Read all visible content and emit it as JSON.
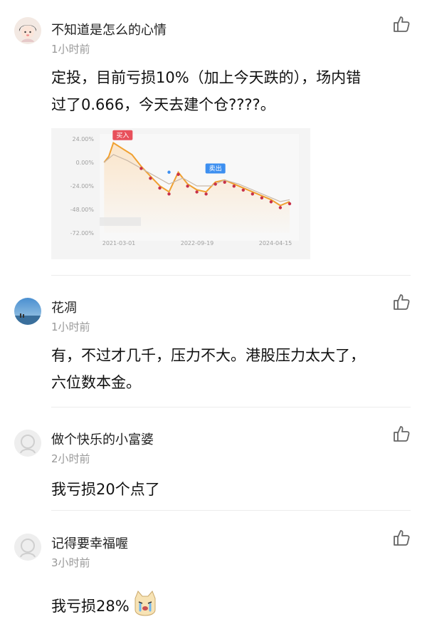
{
  "comments": [
    {
      "username": "不知道是怎么的心情",
      "time": "1小时前",
      "text_line1": "定投，目前亏损10%（加上今天跌的），场内错",
      "text_line2": "过了0.666，今天去建个仓????。",
      "avatar_icon": "girl-avatar-icon"
    },
    {
      "username": "花凋",
      "time": "1小时前",
      "text_line1": "有，不过才几千，压力不大。港股压力太大了，",
      "text_line2": "六位数本金。",
      "avatar_icon": "seaside-avatar-icon"
    },
    {
      "username": "做个快乐的小富婆",
      "time": "2小时前",
      "text_line1": "我亏损20个点了",
      "avatar_icon": "default-avatar-icon"
    },
    {
      "username": "记得要幸福喔",
      "time": "3小时前",
      "text_line1": "我亏损28%",
      "avatar_icon": "default-avatar-icon"
    }
  ],
  "chart_data": {
    "type": "line",
    "y_ticks": [
      "24.00%",
      "0.00%",
      "-24.00%",
      "-48.00%",
      "-72.00%"
    ],
    "x_ticks": [
      "2021-03-01",
      "2022-09-19",
      "2024-04-15"
    ],
    "ylim": [
      -72,
      24
    ],
    "markers": {
      "buy": "买入",
      "sell": "卖出"
    },
    "series": [
      {
        "color": "#f0a030",
        "x": [
          "2021-01",
          "2021-02",
          "2021-03",
          "2021-05",
          "2021-07",
          "2021-09",
          "2021-11",
          "2022-01",
          "2022-03",
          "2022-05",
          "2022-07",
          "2022-09",
          "2022-11",
          "2023-01",
          "2023-03",
          "2023-05",
          "2023-07",
          "2023-09",
          "2023-11",
          "2024-01",
          "2024-03",
          "2024-05"
        ],
        "values": [
          0,
          6,
          20,
          14,
          8,
          -4,
          -14,
          -24,
          -30,
          -10,
          -22,
          -28,
          -30,
          -20,
          -18,
          -22,
          -26,
          -30,
          -34,
          -38,
          -44,
          -40
        ]
      },
      {
        "color": "#c9b8a8",
        "x": [
          "2021-01",
          "2021-03",
          "2021-06",
          "2021-09",
          "2021-12",
          "2022-03",
          "2022-06",
          "2022-09",
          "2022-12",
          "2023-03",
          "2023-06",
          "2023-09",
          "2023-12",
          "2024-03",
          "2024-05"
        ],
        "values": [
          0,
          8,
          2,
          -6,
          -14,
          -22,
          -16,
          -24,
          -24,
          -18,
          -22,
          -28,
          -34,
          -40,
          -38
        ]
      }
    ],
    "labels": {
      "buy": "买入",
      "sell": "卖出"
    },
    "colors": {
      "buy": "#e8505b",
      "sell": "#3d8ff0"
    },
    "grid": false
  }
}
